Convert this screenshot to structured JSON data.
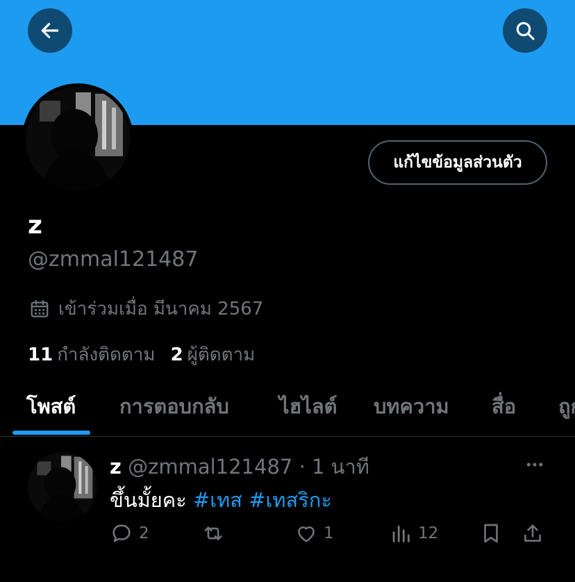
{
  "header": {
    "back_icon": "arrow-left-icon",
    "search_icon": "search-icon",
    "banner_color": "#1d9bf0",
    "button_bg": "#0f4a73"
  },
  "profile": {
    "edit_button_label": "แก้ไขข้อมูลส่วนตัว",
    "display_name": "z",
    "handle": "@zmmal121487",
    "joined_icon": "calendar-icon",
    "joined_text": "เข้าร่วมเมื่อ มีนาคม 2567",
    "following_count": "11",
    "following_label": "กำลังติดตาม",
    "followers_count": "2",
    "followers_label": "ผู้ติดตาม"
  },
  "tabs": [
    {
      "label": "โพสต์",
      "active": true
    },
    {
      "label": "การตอบกลับ"
    },
    {
      "label": "ไฮไลต์"
    },
    {
      "label": "บทความ"
    },
    {
      "label": "สื่อ"
    },
    {
      "label": "ถูกใจ"
    }
  ],
  "post": {
    "name": "z",
    "meta": "@zmmal121487 · 1 นาที",
    "text": "ขึ้นมั้ยคะ",
    "hashtags": [
      "#เทส",
      "#เทสริกะ"
    ],
    "reply_count": "2",
    "like_count": "1",
    "views_count": "12"
  },
  "colors": {
    "accent": "#1d9bf0",
    "muted": "#71767b",
    "background": "#000000"
  }
}
